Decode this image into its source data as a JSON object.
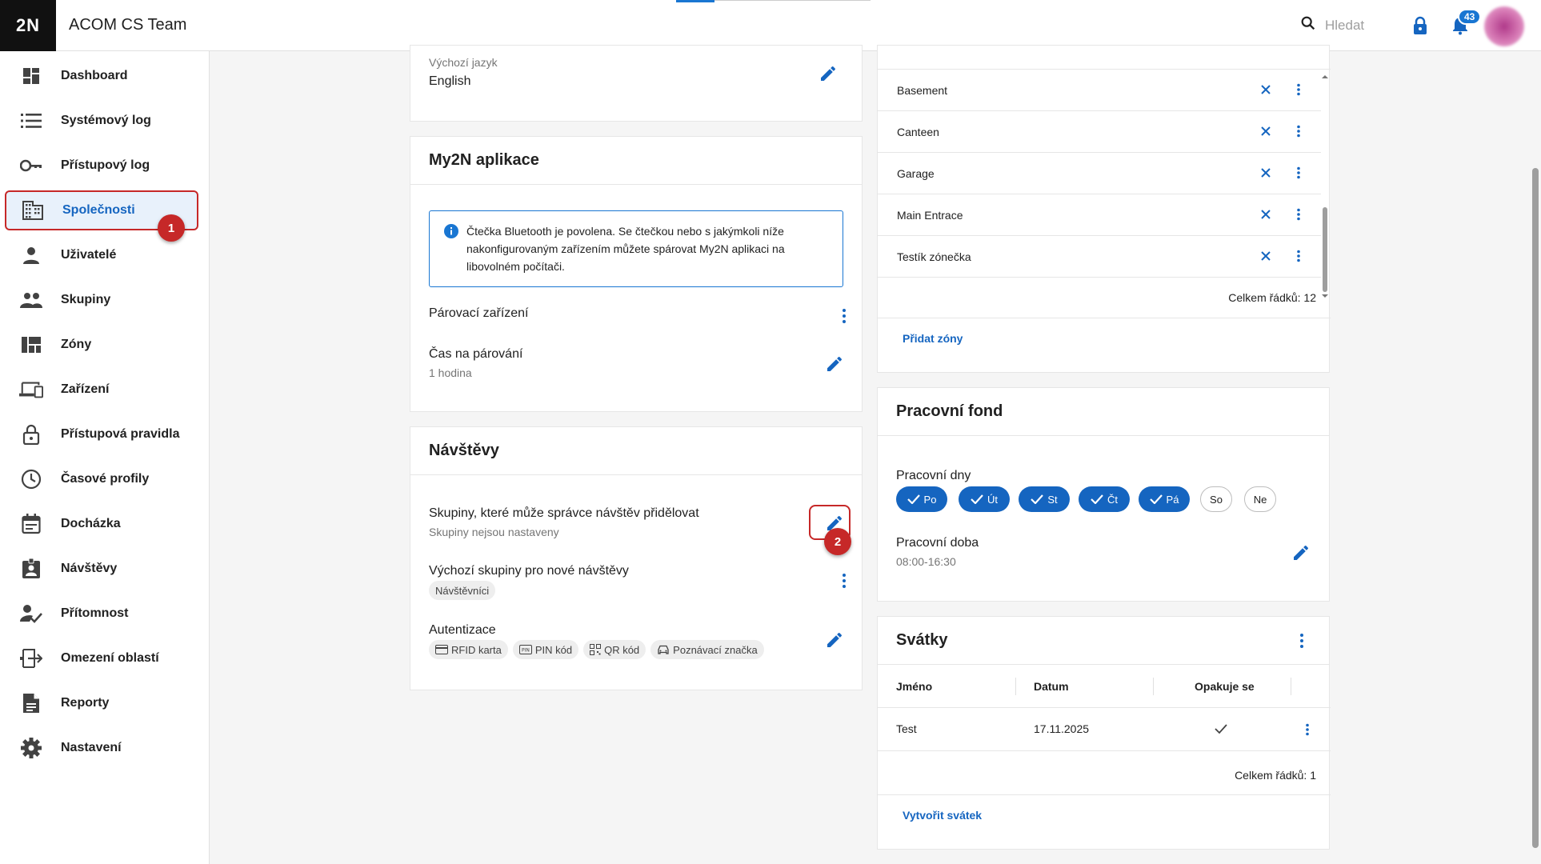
{
  "header": {
    "logo": "2N",
    "title": "ACOM CS Team",
    "search_placeholder": "Hledat",
    "notification_count": "43"
  },
  "sidebar": {
    "items": [
      {
        "label": "Dashboard",
        "icon": "dashboard-icon"
      },
      {
        "label": "Systémový log",
        "icon": "list-icon"
      },
      {
        "label": "Přístupový log",
        "icon": "key-icon"
      },
      {
        "label": "Společnosti",
        "icon": "building-icon"
      },
      {
        "label": "Uživatelé",
        "icon": "person-icon"
      },
      {
        "label": "Skupiny",
        "icon": "group-icon"
      },
      {
        "label": "Zóny",
        "icon": "zones-icon"
      },
      {
        "label": "Zařízení",
        "icon": "devices-icon"
      },
      {
        "label": "Přístupová pravidla",
        "icon": "lock-icon"
      },
      {
        "label": "Časové profily",
        "icon": "clock-icon"
      },
      {
        "label": "Docházka",
        "icon": "calendar-icon"
      },
      {
        "label": "Návštěvy",
        "icon": "visitor-badge-icon"
      },
      {
        "label": "Přítomnost",
        "icon": "presence-icon"
      },
      {
        "label": "Omezení oblastí",
        "icon": "area-restriction-icon"
      },
      {
        "label": "Reporty",
        "icon": "report-icon"
      },
      {
        "label": "Nastavení",
        "icon": "gear-icon"
      }
    ],
    "active_index": 3
  },
  "markers": {
    "one": "1",
    "two": "2"
  },
  "language_card": {
    "label": "Výchozí jazyk",
    "value": "English"
  },
  "my2n_card": {
    "title": "My2N aplikace",
    "info": "Čtečka Bluetooth je povolena. Se čtečkou nebo s jakýmkoli níže nakonfigurovaným zařízením můžete spárovat My2N aplikaci na libovolném počítači.",
    "pairing_device_label": "Párovací zařízení",
    "pairing_time_label": "Čas na párování",
    "pairing_time_value": "1 hodina"
  },
  "visits_card": {
    "title": "Návštěvy",
    "groups_label": "Skupiny, které může správce návštěv přidělovat",
    "groups_value": "Skupiny nejsou nastaveny",
    "default_groups_label": "Výchozí skupiny pro nové návštěvy",
    "default_groups_chip": "Návštěvníci",
    "auth_label": "Autentizace",
    "auth_chips": [
      "RFID karta",
      "PIN kód",
      "QR kód",
      "Poznávací značka"
    ]
  },
  "zones_card": {
    "rows": [
      "Basement",
      "Canteen",
      "Garage",
      "Main Entrace",
      "Testík zónečka"
    ],
    "total": "Celkem řádků: 12",
    "add_link": "Přidat zóny"
  },
  "work_fund_card": {
    "title": "Pracovní fond",
    "workdays_label": "Pracovní dny",
    "days": [
      {
        "label": "Po",
        "on": true
      },
      {
        "label": "Út",
        "on": true
      },
      {
        "label": "St",
        "on": true
      },
      {
        "label": "Čt",
        "on": true
      },
      {
        "label": "Pá",
        "on": true
      },
      {
        "label": "So",
        "on": false
      },
      {
        "label": "Ne",
        "on": false
      }
    ],
    "work_time_label": "Pracovní doba",
    "work_time_value": "08:00-16:30"
  },
  "holidays_card": {
    "title": "Svátky",
    "columns": [
      "Jméno",
      "Datum",
      "Opakuje se"
    ],
    "rows": [
      {
        "name": "Test",
        "date": "17.11.2025",
        "repeats": true
      }
    ],
    "total": "Celkem řádků: 1",
    "create_link": "Vytvořit svátek"
  },
  "colors": {
    "accent": "#1565c0",
    "marker": "#c62828"
  }
}
